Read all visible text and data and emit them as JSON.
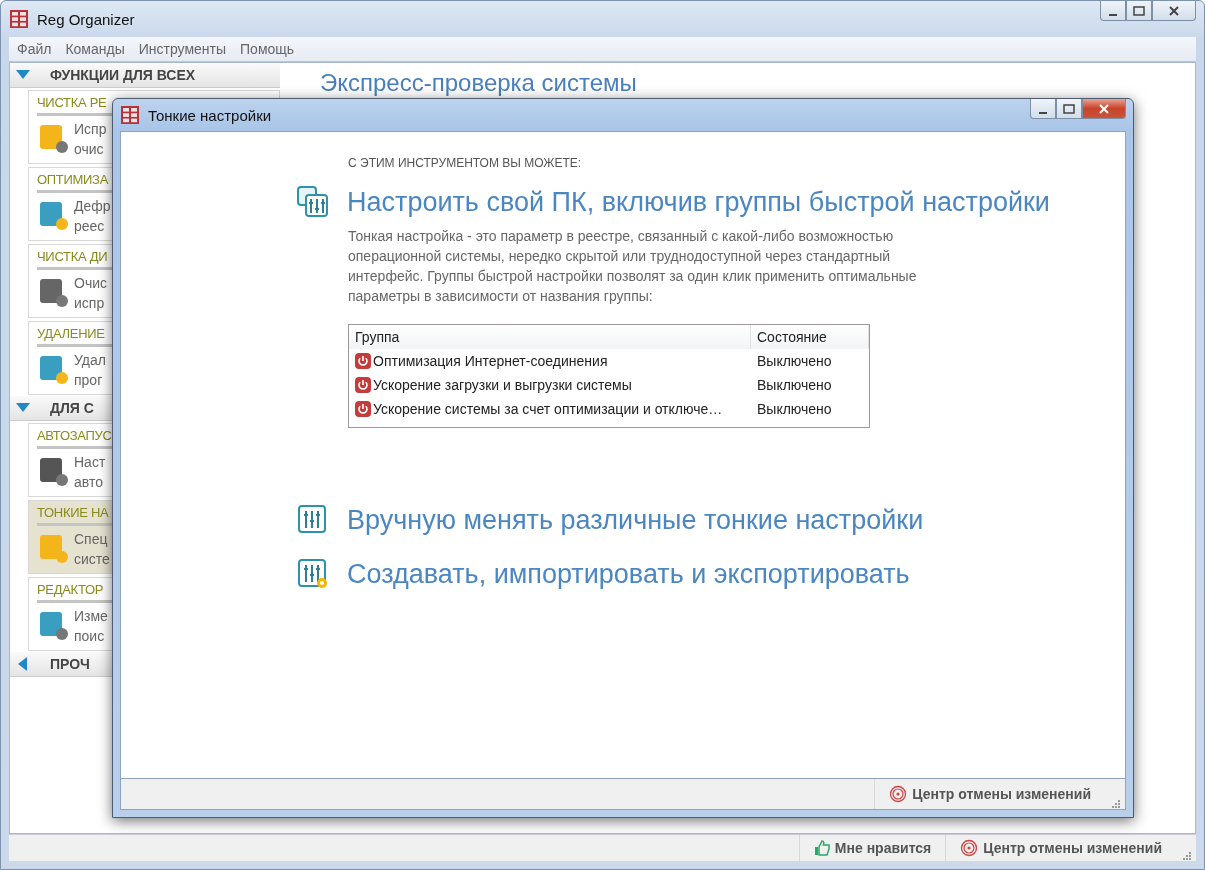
{
  "window": {
    "title": "Reg Organizer"
  },
  "menu": [
    "Файл",
    "Команды",
    "Инструменты",
    "Помощь"
  ],
  "sidebar": {
    "sections": [
      {
        "title": "ФУНКЦИИ ДЛЯ ВСЕХ",
        "expanded": true,
        "items": [
          {
            "title": "ЧИСТКА РЕ",
            "description": [
              "Испр",
              "очис"
            ],
            "selected": false
          },
          {
            "title": "ОПТИМИЗА",
            "description": [
              "Дефр",
              "реес"
            ],
            "selected": false
          },
          {
            "title": "ЧИСТКА ДИ",
            "description": [
              "Очис",
              "испр"
            ],
            "selected": false
          },
          {
            "title": "УДАЛЕНИЕ",
            "description": [
              "Удал",
              "прог"
            ],
            "selected": false
          }
        ]
      },
      {
        "title": "ДЛЯ С",
        "expanded": true,
        "items": [
          {
            "title": "АВТОЗАПУС",
            "description": [
              "Наст",
              "авто"
            ],
            "selected": false
          },
          {
            "title": "ТОНКИЕ НА",
            "description": [
              "Спец",
              "систе"
            ],
            "selected": true
          },
          {
            "title": "РЕДАКТОР",
            "description": [
              "Изме",
              "поис"
            ],
            "selected": false
          }
        ]
      },
      {
        "title": "ПРОЧ",
        "expanded": false
      }
    ]
  },
  "main": {
    "heading": "Экспресс-проверка системы"
  },
  "status_bar": {
    "like": "Мне нравится",
    "undo_center": "Центр отмены изменений"
  },
  "dialog": {
    "title": "Тонкие настройки",
    "intro": "С ЭТИМ ИНСТРУМЕНТОМ ВЫ МОЖЕТЕ:",
    "options": [
      {
        "title": "Настроить свой ПК, включив группы быстрой настройки",
        "description": "Тонкая настройка - это параметр в реестре, связанный с какой-либо возможностью операционной системы, нередко скрытой или труднодоступной через стандартный интерфейс. Группы быстрой настройки позволят за один клик применить оптимальные параметры в зависимости от названия группы:",
        "table": {
          "columns": [
            "Группа",
            "Состояние"
          ],
          "rows": [
            {
              "group": "Оптимизация Интернет-соединения",
              "state": "Выключено",
              "on": false
            },
            {
              "group": "Ускорение загрузки и выгрузки системы",
              "state": "Выключено",
              "on": false
            },
            {
              "group": "Ускорение системы за счет оптимизации и отключе…",
              "state": "Выключено",
              "on": false
            }
          ]
        }
      },
      {
        "title": "Вручную менять различные тонкие настройки"
      },
      {
        "title": "Создавать, импортировать и экспортировать"
      }
    ],
    "status_bar": {
      "undo_center": "Центр отмены изменений"
    }
  }
}
